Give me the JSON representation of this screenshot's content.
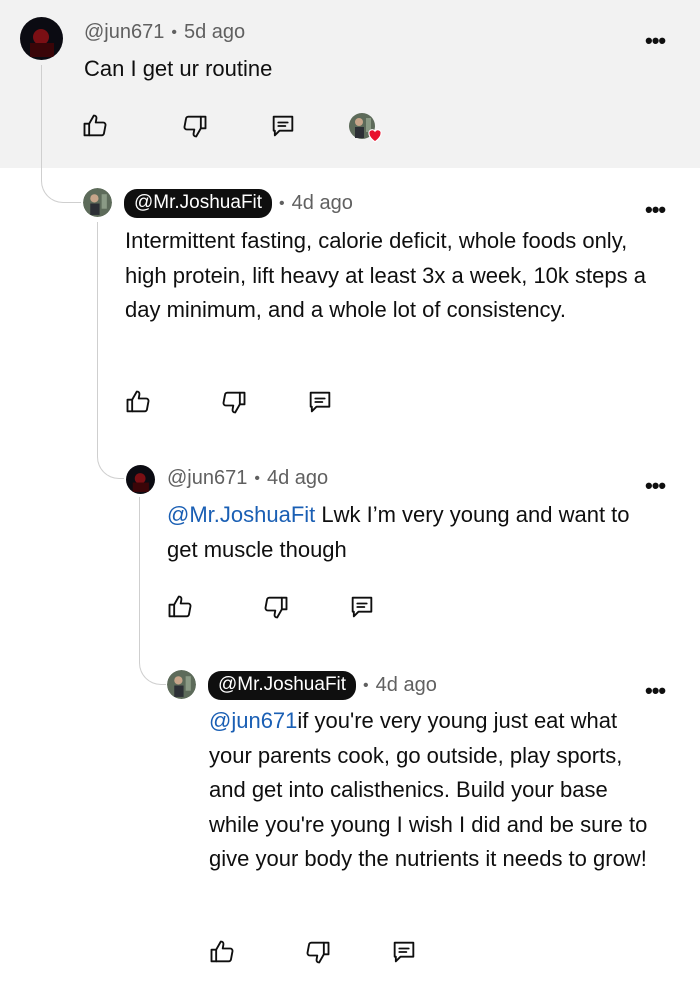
{
  "comments": [
    {
      "handle": "@jun671",
      "time": "5d ago",
      "text": "Can I get ur routine",
      "pill": false
    },
    {
      "handle": "@Mr.JoshuaFit",
      "time": "4d ago",
      "text": "Intermittent fasting, calorie deficit, whole foods only, high protein, lift heavy at least 3x a week, 10k steps a day minimum, and a whole lot of consistency.",
      "pill": true
    },
    {
      "handle": "@jun671",
      "time": "4d ago",
      "mention": "@Mr.JoshuaFit",
      "text": " Lwk I’m very young and want to get muscle though",
      "pill": false
    },
    {
      "handle": "@Mr.JoshuaFit",
      "time": "4d ago",
      "mention": "@jun671",
      "text": "if you're very young just eat what your parents cook, go outside, play sports, and get into calisthenics. Build your base while you're young I wish I did and be sure to give your body the nutrients it needs to grow!",
      "pill": true
    }
  ],
  "separator": "•",
  "more_label": "•••",
  "colors": {
    "mention": "#1a5fb4",
    "heart": "#e8112d",
    "highlight": "#f2f2f2"
  },
  "icons": [
    "like-icon",
    "dislike-icon",
    "reply-icon",
    "creator-heart-icon"
  ]
}
